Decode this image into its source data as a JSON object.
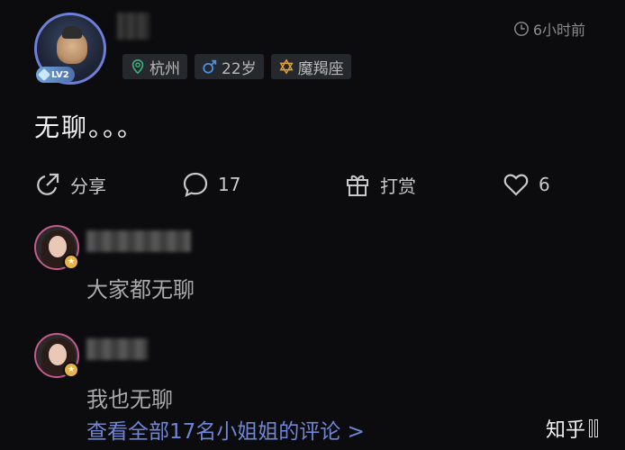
{
  "post": {
    "level": "LV2",
    "time": "6小时前",
    "tags": [
      {
        "icon": "location-pin-icon",
        "label": "杭州",
        "color": "#3db07c"
      },
      {
        "icon": "male-icon",
        "label": "22岁",
        "color": "#4a90e2"
      },
      {
        "icon": "star-of-david-icon",
        "label": "魔羯座",
        "color": "#e0a13a"
      }
    ],
    "text": "无聊。。。"
  },
  "actions": {
    "share": "分享",
    "comments": "17",
    "reward": "打赏",
    "likes": "6"
  },
  "comments": [
    {
      "text": "大家都无聊"
    },
    {
      "text": "我也无聊"
    }
  ],
  "view_all": "查看全部17名小姐姐的评论 >",
  "watermark": "知乎"
}
